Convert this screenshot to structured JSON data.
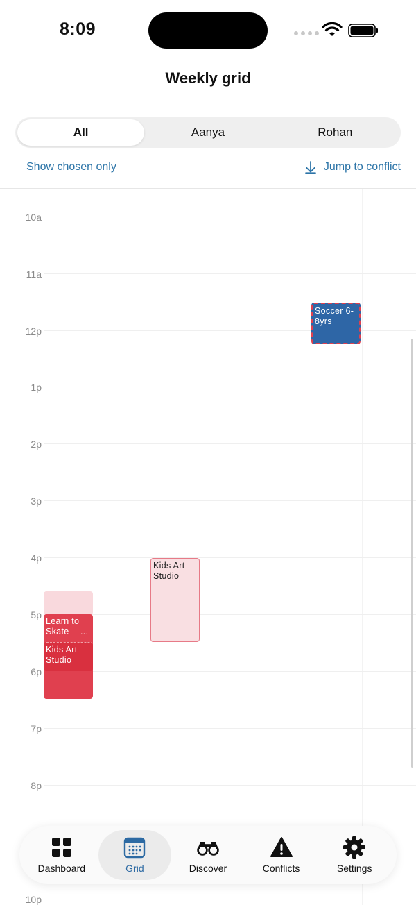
{
  "status": {
    "time": "8:09"
  },
  "header": {
    "title": "Weekly grid"
  },
  "segments": [
    {
      "label": "All",
      "active": true
    },
    {
      "label": "Aanya",
      "active": false
    },
    {
      "label": "Rohan",
      "active": false
    }
  ],
  "links": {
    "show_chosen": "Show chosen only",
    "jump_conflict": "Jump to conflict"
  },
  "grid": {
    "hours": [
      "10a",
      "11a",
      "12p",
      "1p",
      "2p",
      "3p",
      "4p",
      "5p",
      "6p",
      "7p",
      "8p",
      "10p"
    ],
    "events": [
      {
        "title": "Soccer 6-8yrs"
      },
      {
        "title": "Kids Art Studio"
      },
      {
        "title": "Learn to Skate —..."
      },
      {
        "title": "Kids Art Studio"
      }
    ]
  },
  "tabs": [
    {
      "label": "Dashboard",
      "icon": "grid-icon",
      "active": false
    },
    {
      "label": "Grid",
      "icon": "calendar-icon",
      "active": true
    },
    {
      "label": "Discover",
      "icon": "binoculars-icon",
      "active": false
    },
    {
      "label": "Conflicts",
      "icon": "warning-icon",
      "active": false
    },
    {
      "label": "Settings",
      "icon": "gear-icon",
      "active": false
    }
  ],
  "colors": {
    "accent": "#2d75a8",
    "conflict_red": "#e0404f",
    "event_blue": "#2e66a6"
  }
}
